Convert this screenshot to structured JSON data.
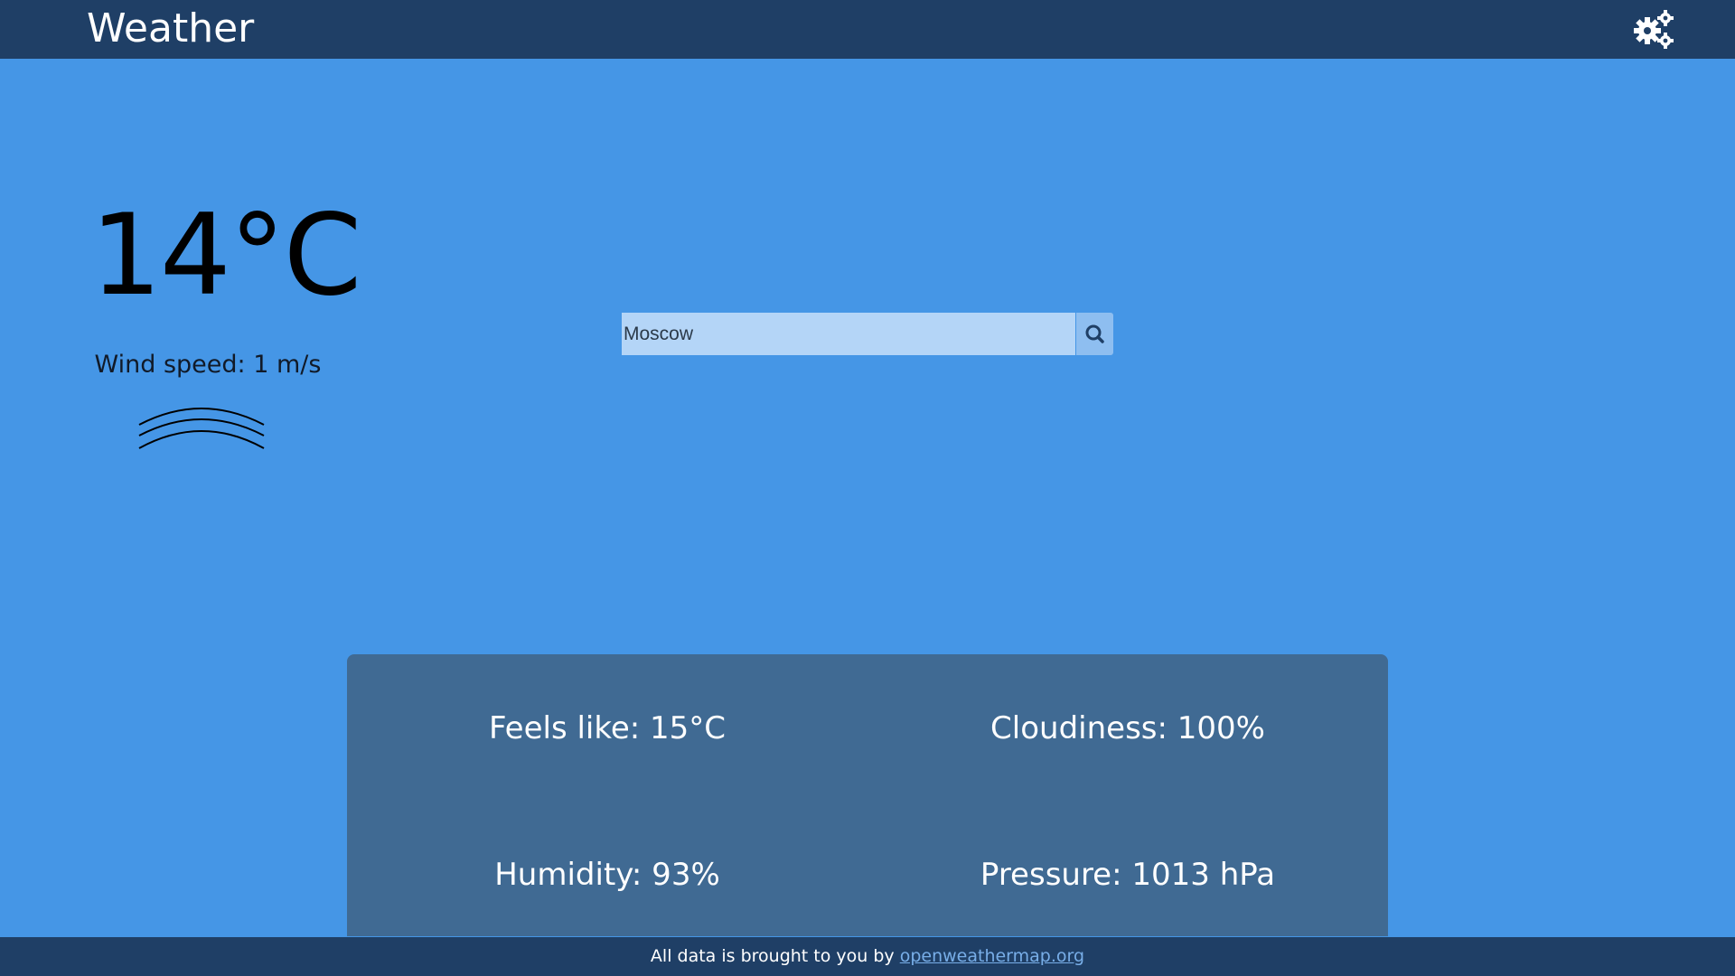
{
  "header": {
    "title": "Weather",
    "settings_icon": "gears-icon"
  },
  "current": {
    "temperature": "14°C",
    "wind_speed": "Wind speed: 1 m/s",
    "wind_icon": "wind-waves-icon"
  },
  "search": {
    "value": "Moscow",
    "button_icon": "search-icon"
  },
  "details": {
    "feels_like": "Feels like: 15°C",
    "cloudiness": "Cloudiness: 100%",
    "humidity": "Humidity: 93%",
    "pressure": "Pressure: 1013 hPa"
  },
  "footer": {
    "text": "All data is brought to you by ",
    "link": "openweathermap.org"
  },
  "colors": {
    "background": "#4596e6",
    "bar": "#1f3f66",
    "panel": "#406a93",
    "search_field": "#b4d5f7",
    "search_button": "#8ebef0"
  }
}
